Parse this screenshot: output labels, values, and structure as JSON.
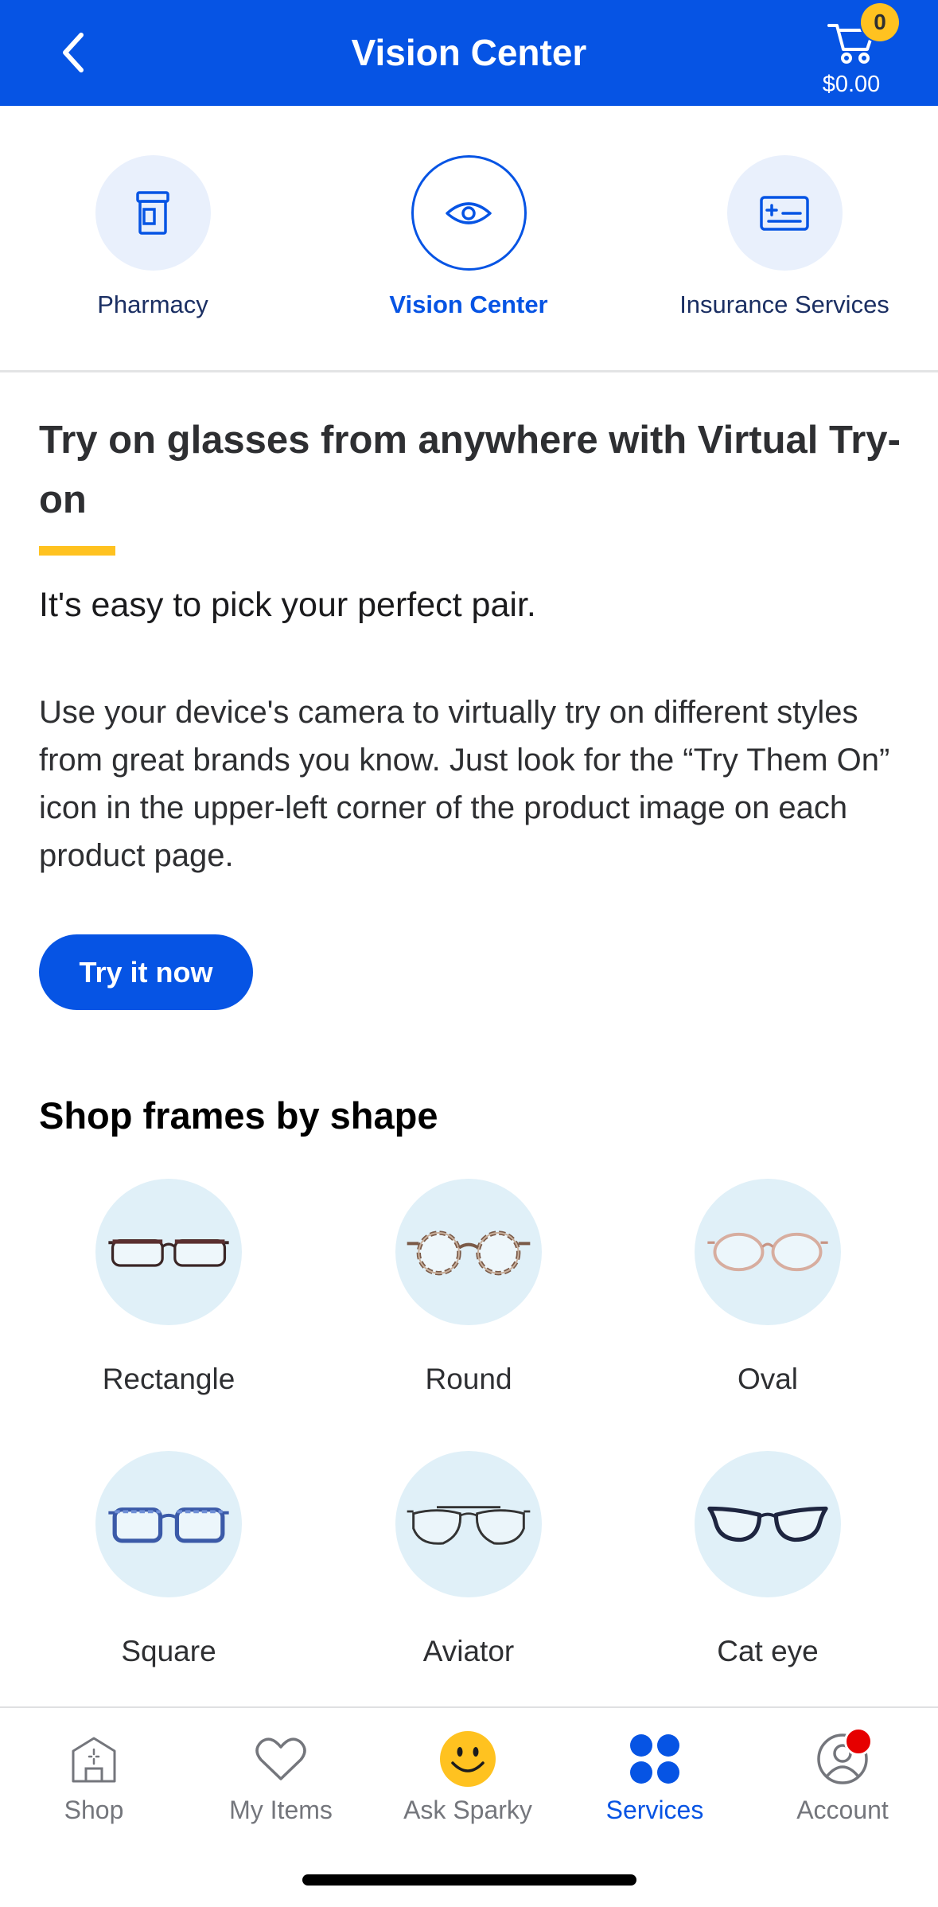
{
  "header": {
    "title": "Vision Center",
    "back_icon": "chevron-left-icon",
    "cart_icon": "cart-icon",
    "cart_count": "0",
    "cart_total": "$0.00"
  },
  "services_nav": {
    "items": [
      {
        "label": "Pharmacy",
        "icon": "pharmacy-bottle-icon",
        "active": false
      },
      {
        "label": "Vision Center",
        "icon": "eye-icon",
        "active": true
      },
      {
        "label": "Insurance Services",
        "icon": "insurance-card-icon",
        "active": false
      }
    ]
  },
  "hero": {
    "heading": "Try on glasses from anywhere with Virtual Try-on",
    "subheading": "It's easy to pick your perfect pair.",
    "body": "Use your device's camera to virtually try on different styles from great brands you know. Just look for the “Try Them On” icon in the upper-left corner of the product image on each product page.",
    "cta_label": "Try it now"
  },
  "shapes": {
    "title": "Shop frames by shape",
    "items": [
      {
        "label": "Rectangle",
        "icon": "rectangle-glasses-icon"
      },
      {
        "label": "Round",
        "icon": "round-glasses-icon"
      },
      {
        "label": "Oval",
        "icon": "oval-glasses-icon"
      },
      {
        "label": "Square",
        "icon": "square-glasses-icon"
      },
      {
        "label": "Aviator",
        "icon": "aviator-glasses-icon"
      },
      {
        "label": "Cat eye",
        "icon": "cat-eye-glasses-icon"
      }
    ]
  },
  "tab_bar": {
    "items": [
      {
        "label": "Shop",
        "icon": "store-icon",
        "active": false
      },
      {
        "label": "My Items",
        "icon": "heart-icon",
        "active": false
      },
      {
        "label": "Ask Sparky",
        "icon": "sparky-smiley-icon",
        "active": false
      },
      {
        "label": "Services",
        "icon": "services-grid-icon",
        "active": true
      },
      {
        "label": "Account",
        "icon": "account-icon",
        "active": false,
        "has_notification_badge": true
      }
    ]
  },
  "colors": {
    "brand_blue": "#0654e4",
    "accent_yellow": "#ffc220",
    "notification_red": "#e60000",
    "shape_circle_bg": "#e0f0f8",
    "text_dark": "#2e2f32",
    "tab_inactive": "#74767c"
  }
}
